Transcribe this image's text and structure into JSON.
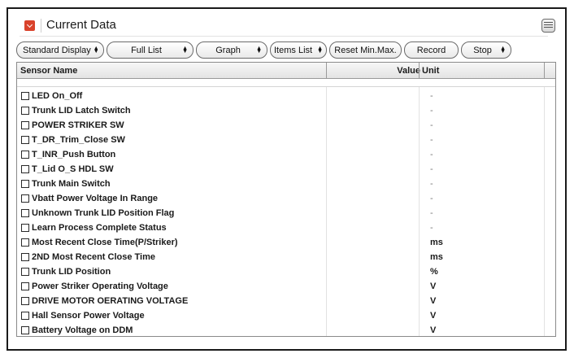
{
  "window": {
    "title": "Current Data",
    "title_icon": "chevron-down-icon",
    "menu_icon": "list-menu-icon",
    "accent_color": "#d9422b"
  },
  "toolbar": {
    "standard_display": "Standard Display",
    "full_list": "Full List",
    "graph": "Graph",
    "items_list": "Items List",
    "reset_min_max": "Reset Min.Max.",
    "record": "Record",
    "stop": "Stop"
  },
  "table": {
    "columns": {
      "name": "Sensor Name",
      "value": "Value",
      "unit": "Unit"
    },
    "rows": [
      {
        "name": "LED On_Off",
        "value": "",
        "unit": "-"
      },
      {
        "name": "Trunk LID Latch Switch",
        "value": "",
        "unit": "-"
      },
      {
        "name": "POWER STRIKER SW",
        "value": "",
        "unit": "-"
      },
      {
        "name": "T_DR_Trim_Close SW",
        "value": "",
        "unit": "-"
      },
      {
        "name": "T_INR_Push Button",
        "value": "",
        "unit": "-"
      },
      {
        "name": "T_Lid O_S HDL SW",
        "value": "",
        "unit": "-"
      },
      {
        "name": "Trunk Main Switch",
        "value": "",
        "unit": "-"
      },
      {
        "name": "Vbatt Power Voltage In Range",
        "value": "",
        "unit": "-"
      },
      {
        "name": "Unknown Trunk LID Position Flag",
        "value": "",
        "unit": "-"
      },
      {
        "name": "Learn Process Complete Status",
        "value": "",
        "unit": "-"
      },
      {
        "name": "Most Recent Close Time(P/Striker)",
        "value": "",
        "unit": "ms"
      },
      {
        "name": "2ND Most Recent Close Time",
        "value": "",
        "unit": "ms"
      },
      {
        "name": "Trunk LID Position",
        "value": "",
        "unit": "%"
      },
      {
        "name": "Power Striker Operating Voltage",
        "value": "",
        "unit": "V"
      },
      {
        "name": "DRIVE MOTOR OERATING VOLTAGE",
        "value": "",
        "unit": "V"
      },
      {
        "name": "Hall Sensor Power Voltage",
        "value": "",
        "unit": "V"
      },
      {
        "name": "Battery Voltage on DDM",
        "value": "",
        "unit": "V"
      }
    ]
  }
}
